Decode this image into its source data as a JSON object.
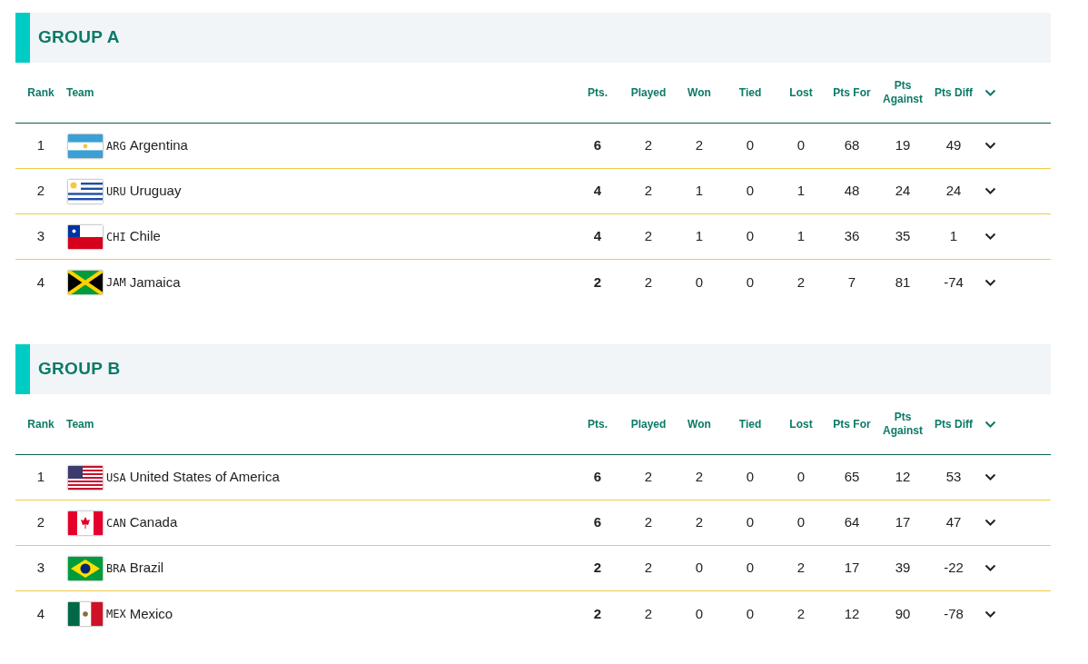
{
  "groups": [
    {
      "title": "GROUP A",
      "columns": [
        "Rank",
        "Team",
        "Pts.",
        "Played",
        "Won",
        "Tied",
        "Lost",
        "Pts For",
        "Pts Against",
        "Pts Diff"
      ],
      "rows": [
        {
          "rank": "1",
          "kind": "argentina",
          "code": "ARG",
          "team": "Argentina",
          "pts": "6",
          "played": "2",
          "won": "2",
          "tied": "0",
          "lost": "0",
          "pts_for": "68",
          "pts_against": "19",
          "pts_diff": "49"
        },
        {
          "rank": "2",
          "kind": "uruguay",
          "code": "URU",
          "team": "Uruguay",
          "pts": "4",
          "played": "2",
          "won": "1",
          "tied": "0",
          "lost": "1",
          "pts_for": "48",
          "pts_against": "24",
          "pts_diff": "24"
        },
        {
          "rank": "3",
          "kind": "chile",
          "code": "CHI",
          "team": "Chile",
          "pts": "4",
          "played": "2",
          "won": "1",
          "tied": "0",
          "lost": "1",
          "pts_for": "36",
          "pts_against": "35",
          "pts_diff": "1"
        },
        {
          "rank": "4",
          "kind": "jamaica",
          "code": "JAM",
          "team": "Jamaica",
          "pts": "2",
          "played": "2",
          "won": "0",
          "tied": "0",
          "lost": "2",
          "pts_for": "7",
          "pts_against": "81",
          "pts_diff": "-74"
        }
      ]
    },
    {
      "title": "GROUP B",
      "columns": [
        "Rank",
        "Team",
        "Pts.",
        "Played",
        "Won",
        "Tied",
        "Lost",
        "Pts For",
        "Pts Against",
        "Pts Diff"
      ],
      "rows": [
        {
          "rank": "1",
          "kind": "usa",
          "code": "USA",
          "team": "United States of America",
          "pts": "6",
          "played": "2",
          "won": "2",
          "tied": "0",
          "lost": "0",
          "pts_for": "65",
          "pts_against": "12",
          "pts_diff": "53"
        },
        {
          "rank": "2",
          "kind": "canada",
          "code": "CAN",
          "team": "Canada",
          "pts": "6",
          "played": "2",
          "won": "2",
          "tied": "0",
          "lost": "0",
          "pts_for": "64",
          "pts_against": "17",
          "pts_diff": "47"
        },
        {
          "rank": "3",
          "kind": "brazil",
          "code": "BRA",
          "team": "Brazil",
          "pts": "2",
          "played": "2",
          "won": "0",
          "tied": "0",
          "lost": "2",
          "pts_for": "17",
          "pts_against": "39",
          "pts_diff": "-22"
        },
        {
          "rank": "4",
          "kind": "mexico",
          "code": "MEX",
          "team": "Mexico",
          "pts": "2",
          "played": "2",
          "won": "0",
          "tied": "0",
          "lost": "2",
          "pts_for": "12",
          "pts_against": "90",
          "pts_diff": "-78"
        }
      ]
    }
  ]
}
